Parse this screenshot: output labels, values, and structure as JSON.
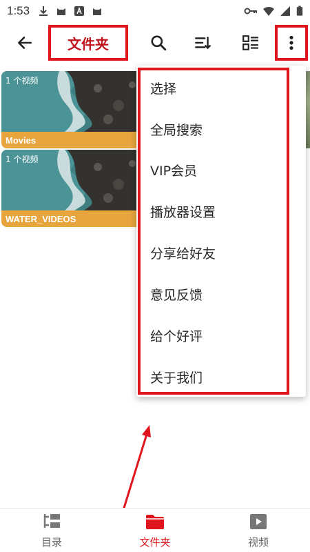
{
  "status_bar": {
    "time": "1:53"
  },
  "toolbar": {
    "title": "文件夹"
  },
  "folders": [
    {
      "name": "Movies",
      "count": "1 个视频"
    },
    {
      "name": "WATER_VIDEOS",
      "count": "1 个视频"
    }
  ],
  "menu": {
    "items": [
      {
        "label": "选择"
      },
      {
        "label": "全局搜索"
      },
      {
        "label": "VIP会员"
      },
      {
        "label": "播放器设置"
      },
      {
        "label": "分享给好友"
      },
      {
        "label": "意见反馈"
      },
      {
        "label": "给个好评"
      },
      {
        "label": "关于我们"
      }
    ]
  },
  "bottom_nav": {
    "items": [
      {
        "label": "目录",
        "icon": "directory-icon",
        "active": false
      },
      {
        "label": "文件夹",
        "icon": "folder-icon",
        "active": true
      },
      {
        "label": "视频",
        "icon": "video-icon",
        "active": false
      }
    ]
  },
  "colors": {
    "highlight": "#e0161f",
    "accent": "#e0161f",
    "card_bar": "#e8a53e"
  }
}
